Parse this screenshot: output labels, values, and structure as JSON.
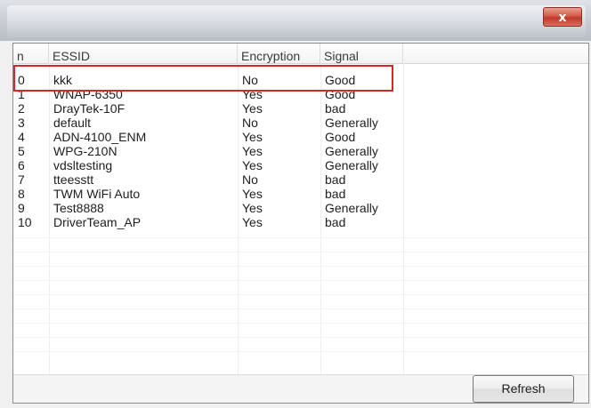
{
  "window": {
    "close_glyph": "x"
  },
  "table": {
    "headers": [
      "n",
      "ESSID",
      "Encryption",
      "Signal"
    ],
    "rows": [
      {
        "n": "0",
        "essid": "kkk",
        "encryption": "No",
        "signal": "Good"
      },
      {
        "n": "1",
        "essid": "WNAP-6350",
        "encryption": "Yes",
        "signal": "Good"
      },
      {
        "n": "2",
        "essid": "DrayTek-10F",
        "encryption": "Yes",
        "signal": "bad"
      },
      {
        "n": "3",
        "essid": "default",
        "encryption": "No",
        "signal": "Generally"
      },
      {
        "n": "4",
        "essid": "ADN-4100_ENM",
        "encryption": "Yes",
        "signal": "Good"
      },
      {
        "n": "5",
        "essid": "WPG-210N",
        "encryption": "Yes",
        "signal": "Generally"
      },
      {
        "n": "6",
        "essid": "vdsltesting",
        "encryption": "Yes",
        "signal": "Generally"
      },
      {
        "n": "7",
        "essid": "tteesstt",
        "encryption": "No",
        "signal": "bad"
      },
      {
        "n": "8",
        "essid": "TWM WiFi Auto",
        "encryption": "Yes",
        "signal": "bad"
      },
      {
        "n": "9",
        "essid": "Test8888",
        "encryption": "Yes",
        "signal": "Generally"
      },
      {
        "n": "10",
        "essid": "DriverTeam_AP",
        "encryption": "Yes",
        "signal": "bad"
      }
    ],
    "highlight_color": "#d8262b"
  },
  "footer": {
    "refresh_label": "Refresh"
  }
}
